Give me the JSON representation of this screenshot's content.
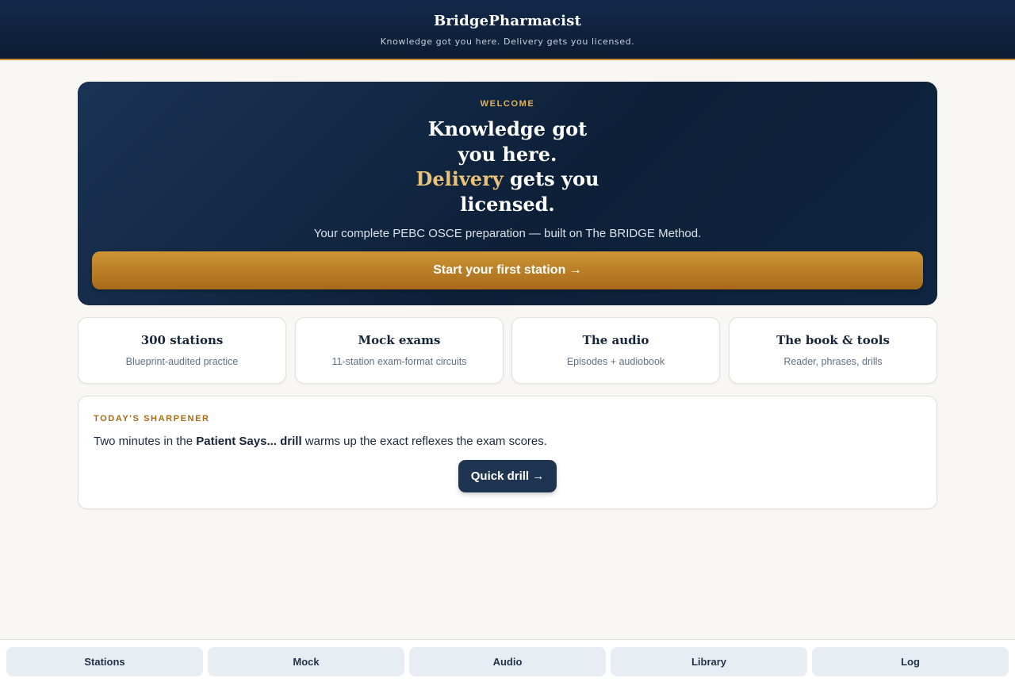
{
  "header": {
    "brand": "BridgePharmacist",
    "tagline": "Knowledge got you here. Delivery gets you licensed."
  },
  "hero": {
    "kicker": "WELCOME",
    "title_line1": "Knowledge got",
    "title_line2": "you here.",
    "title_accent": "Delivery",
    "title_line3_rest": " gets you",
    "title_line4": "licensed.",
    "subtitle": "Your complete PEBC OSCE preparation — built on The BRIDGE Method.",
    "cta_label": "Start your first station →"
  },
  "cards": [
    {
      "title": "300 stations",
      "subtitle": "Blueprint-audited practice"
    },
    {
      "title": "Mock exams",
      "subtitle": "11-station exam-format circuits"
    },
    {
      "title": "The audio",
      "subtitle": "Episodes + audiobook"
    },
    {
      "title": "The book & tools",
      "subtitle": "Reader, phrases, drills"
    }
  ],
  "sharpener": {
    "kicker": "TODAY'S SHARPENER",
    "text_before": "Two minutes in the ",
    "text_bold": "Patient Says... drill",
    "text_after": " warms up the exact reflexes the exam scores.",
    "button_label": "Quick drill →"
  },
  "bottom_nav": [
    {
      "label": "Stations"
    },
    {
      "label": "Mock"
    },
    {
      "label": "Audio"
    },
    {
      "label": "Library"
    },
    {
      "label": "Log"
    }
  ],
  "colors": {
    "navy": "#0c1d33",
    "gold": "#c8902e",
    "accent_text": "#e8c27a",
    "background": "#f9f7f3"
  }
}
